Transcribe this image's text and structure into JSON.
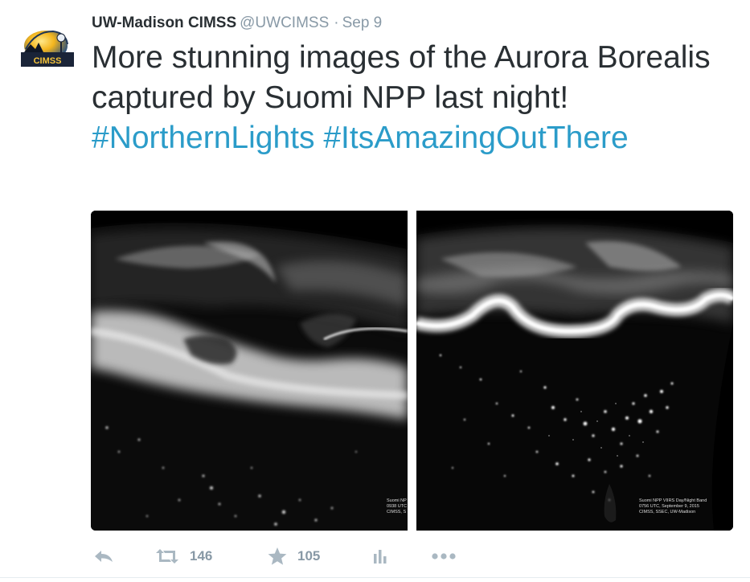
{
  "tweet": {
    "fullname": "UW-Madison CIMSS",
    "username": "@UWCIMSS",
    "separator": "·",
    "time": "Sep 9",
    "avatar_text": "CIMSS",
    "text_plain": "More stunning images of the Aurora Borealis captured by Suomi NPP last night! ",
    "hashtag_1": "#NorthernLights",
    "hashtag_2": "#ItsAmazingOutThere",
    "photos": [
      {
        "caption_lines": [
          "Suomi NP",
          "0938 UTC",
          "CIMSS, S"
        ]
      },
      {
        "caption_lines": [
          "Suomi NPP VIIRS Day/Night Band",
          "0756 UTC, September 9, 2015",
          "CIMSS, SSEC, UW-Madison"
        ]
      }
    ],
    "actions": {
      "retweet_count": "146",
      "favorite_count": "105"
    }
  },
  "icons": {
    "reply": "reply-icon",
    "retweet": "retweet-icon",
    "favorite": "star-icon",
    "analytics": "analytics-icon",
    "more": "more-icon"
  },
  "colors": {
    "hashtag": "#2b9cc9",
    "name": "#292f33",
    "meta": "#8899a6",
    "icon": "#aab8c2"
  }
}
